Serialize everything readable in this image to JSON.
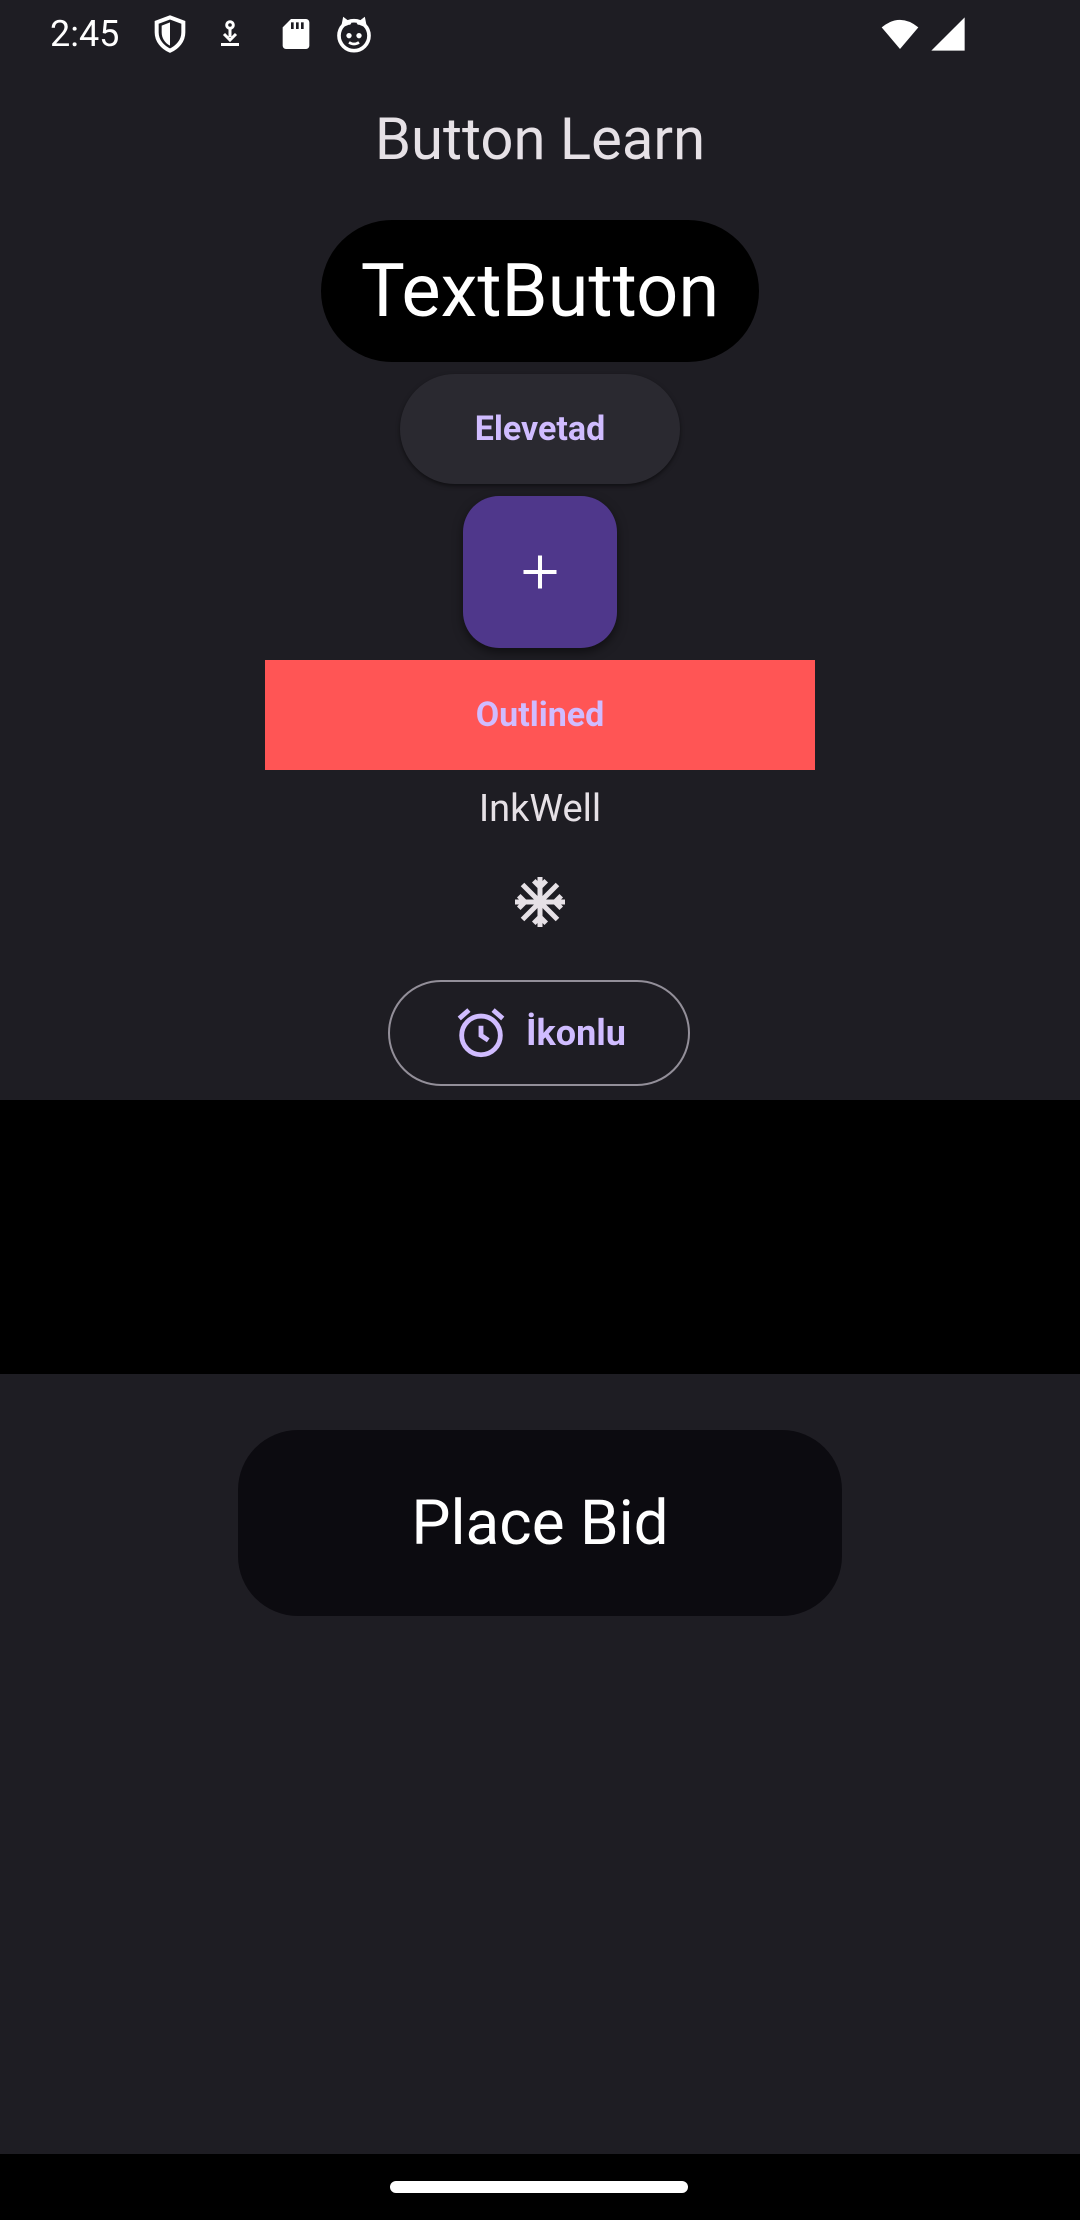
{
  "status_bar": {
    "time": "2:45",
    "left_icons": [
      "shield-icon",
      "download-icon",
      "sd-card-icon",
      "cat-face-icon"
    ],
    "right_icons": [
      "wifi-icon",
      "cell-signal-icon"
    ]
  },
  "app": {
    "title": "Button Learn"
  },
  "buttons": {
    "text_button": "TextButton",
    "elevated": "Elevetad",
    "fab_icon": "add-icon",
    "outlined": "Outlined",
    "inkwell": "InkWell",
    "inkwell_icon": "snowflake-icon",
    "icon_button_label": "İkonlu",
    "icon_button_icon": "alarm-icon",
    "place_bid": "Place Bid"
  },
  "colors": {
    "background": "#1e1d23",
    "primary_text": "#d0bcff",
    "fab": "#4f378b",
    "outlined_fill": "#ff5555",
    "text_button_bg": "#000000",
    "place_bid_bg": "#0c0b10"
  }
}
